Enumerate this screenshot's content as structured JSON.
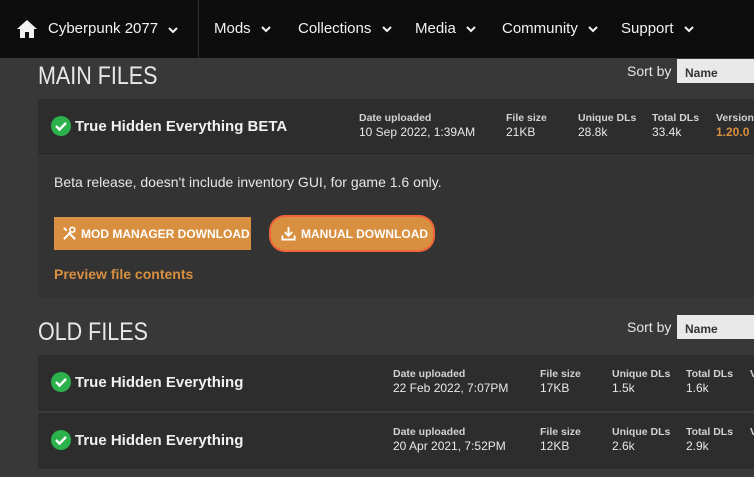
{
  "nav": {
    "game": "Cyberpunk 2077",
    "items": [
      {
        "label": "Mods"
      },
      {
        "label": "Collections"
      },
      {
        "label": "Media"
      },
      {
        "label": "Community"
      },
      {
        "label": "Support"
      }
    ]
  },
  "main_files": {
    "title": "MAIN FILES",
    "sort_label": "Sort by",
    "sort_value": "Name",
    "file": {
      "name": "True Hidden Everything BETA",
      "date_label": "Date uploaded",
      "date": "10 Sep 2022, 1:39AM",
      "size_label": "File size",
      "size": "21KB",
      "unique_label": "Unique DLs",
      "unique": "28.8k",
      "total_label": "Total DLs",
      "total": "33.4k",
      "version_label": "Version",
      "version": "1.20.0"
    },
    "description": "Beta release, doesn't include inventory GUI, for game 1.6 only.",
    "mod_manager_label": "MOD MANAGER DOWNLOAD",
    "manual_label": "MANUAL DOWNLOAD",
    "preview_label": "Preview file contents"
  },
  "old_files": {
    "title": "OLD FILES",
    "sort_label": "Sort by",
    "sort_value": "Name",
    "files": [
      {
        "name": "True Hidden Everything",
        "date_label": "Date uploaded",
        "date": "22 Feb 2022, 7:07PM",
        "size_label": "File size",
        "size": "17KB",
        "unique_label": "Unique DLs",
        "unique": "1.5k",
        "total_label": "Total DLs",
        "total": "1.6k",
        "version_label": "V"
      },
      {
        "name": "True Hidden Everything",
        "date_label": "Date uploaded",
        "date": "20 Apr 2021, 7:52PM",
        "size_label": "File size",
        "size": "12KB",
        "unique_label": "Unique DLs",
        "unique": "2.6k",
        "total_label": "Total DLs",
        "total": "2.9k",
        "version_label": "V"
      }
    ]
  },
  "colors": {
    "nav_bg": "#0d0d0d",
    "page_bg": "#383838",
    "accent": "#d98f40",
    "check": "#2bb24c"
  }
}
